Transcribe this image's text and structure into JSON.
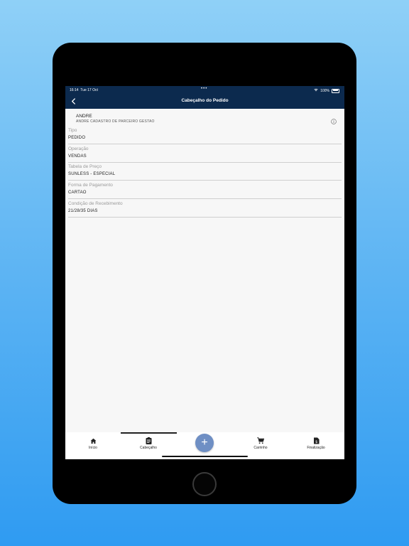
{
  "status_bar": {
    "time": "16:14",
    "date": "Tue 17 Oct",
    "dots": "•••",
    "battery": "100%"
  },
  "header": {
    "title": "Cabeçalho do Pedido",
    "back_icon": "chevron-left-icon"
  },
  "partner": {
    "name": "ANDRE",
    "subtitle": "ANDRE CADASTRO DE PARCEIRO GESTAO",
    "info_icon": "info-circle-icon"
  },
  "fields": [
    {
      "label": "Tipo",
      "value": "PEDIDO"
    },
    {
      "label": "Operação",
      "value": "VENDAS"
    },
    {
      "label": "Tabela de Preço",
      "value": "SUNLESS - ESPECIAL"
    },
    {
      "label": "Forma de Pagamento",
      "value": "CARTAO"
    },
    {
      "label": "Condição de Recebimento",
      "value": "21/28/35 DIAS"
    }
  ],
  "bottom_nav": {
    "items": [
      {
        "label": "Início",
        "icon": "home-icon"
      },
      {
        "label": "Cabeçalho",
        "icon": "clipboard-icon",
        "active": true
      },
      {
        "label": "Carrinho",
        "icon": "cart-icon"
      },
      {
        "label": "Finalização",
        "icon": "checkout-icon"
      }
    ],
    "fab_symbol": "+"
  },
  "colors": {
    "header_bg": "#0c2a4e",
    "fab": "#6f8fc4",
    "background": "#f7f7f7"
  }
}
